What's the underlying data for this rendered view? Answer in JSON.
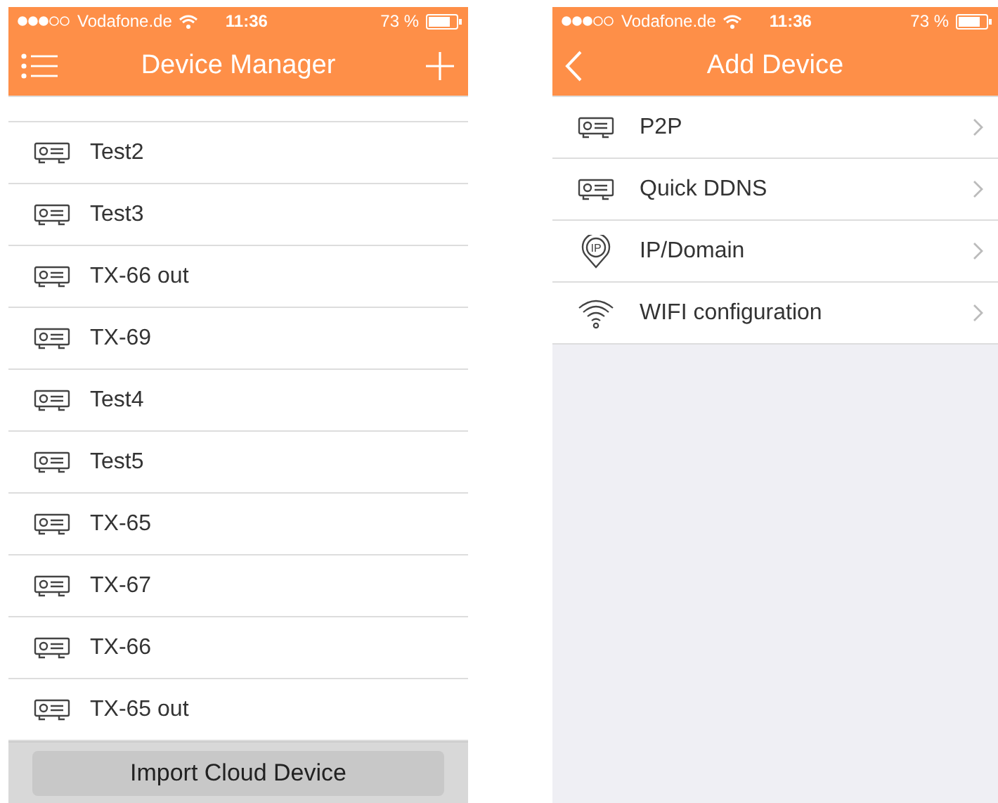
{
  "device_manager": {
    "status_bar": {
      "carrier": "Vodafone.de",
      "time": "11:36",
      "battery": "73 %"
    },
    "nav": {
      "title": "Device Manager"
    },
    "devices": [
      {
        "name": "Test2"
      },
      {
        "name": "Test3"
      },
      {
        "name": "TX-66 out"
      },
      {
        "name": "TX-69"
      },
      {
        "name": "Test4"
      },
      {
        "name": "Test5"
      },
      {
        "name": "TX-65"
      },
      {
        "name": "TX-67"
      },
      {
        "name": "TX-66"
      },
      {
        "name": "TX-65 out"
      }
    ],
    "import_button": "Import Cloud Device"
  },
  "add_device": {
    "status_bar": {
      "carrier": "Vodafone.de",
      "time": "11:36",
      "battery": "73 %"
    },
    "nav": {
      "title": "Add Device"
    },
    "options": [
      {
        "label": "P2P",
        "kind": "device"
      },
      {
        "label": "Quick DDNS",
        "kind": "device"
      },
      {
        "label": "IP/Domain",
        "kind": "ip",
        "icon_text": "IP"
      },
      {
        "label": "WIFI configuration",
        "kind": "wifi"
      }
    ]
  }
}
